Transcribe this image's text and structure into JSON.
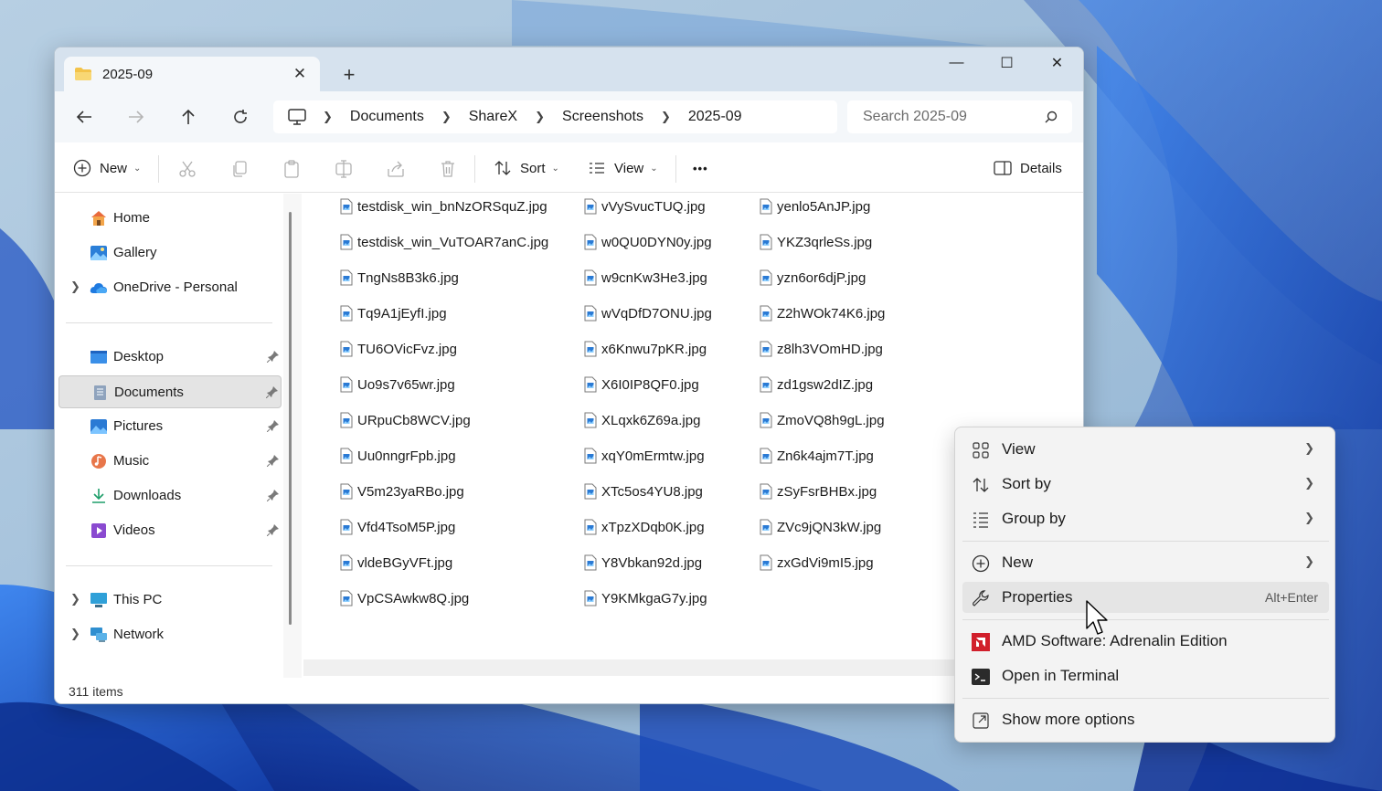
{
  "window": {
    "tab_title": "2025-09",
    "controls": {
      "minimize": "—",
      "maximize": "☐",
      "close": "✕"
    }
  },
  "nav": {
    "back_icon": "arrow-left-icon",
    "forward_icon": "arrow-right-icon",
    "up_icon": "arrow-up-icon",
    "refresh_icon": "refresh-icon",
    "breadcrumbs": [
      "Documents",
      "ShareX",
      "Screenshots",
      "2025-09"
    ],
    "search_placeholder": "Search 2025-09"
  },
  "toolbar": {
    "new_label": "New",
    "sort_label": "Sort",
    "view_label": "View",
    "more_label": "•••",
    "details_label": "Details"
  },
  "sidebar": {
    "home": "Home",
    "gallery": "Gallery",
    "onedrive": "OneDrive - Personal",
    "desktop": "Desktop",
    "documents": "Documents",
    "pictures": "Pictures",
    "music": "Music",
    "downloads": "Downloads",
    "videos": "Videos",
    "thispc": "This PC",
    "network": "Network"
  },
  "files": {
    "col1": [
      "testdisk_win_bnNzORSquZ.jpg",
      "testdisk_win_VuTOAR7anC.jpg",
      "TngNs8B3k6.jpg",
      "Tq9A1jEyfI.jpg",
      "TU6OVicFvz.jpg",
      "Uo9s7v65wr.jpg",
      "URpuCb8WCV.jpg",
      "Uu0nngrFpb.jpg",
      "V5m23yaRBo.jpg",
      "Vfd4TsoM5P.jpg",
      "vldeBGyVFt.jpg",
      "VpCSAwkw8Q.jpg"
    ],
    "col2": [
      "vVySvucTUQ.jpg",
      "w0QU0DYN0y.jpg",
      "w9cnKw3He3.jpg",
      "wVqDfD7ONU.jpg",
      "x6Knwu7pKR.jpg",
      "X6I0IP8QF0.jpg",
      "XLqxk6Z69a.jpg",
      "xqY0mErmtw.jpg",
      "XTc5os4YU8.jpg",
      "xTpzXDqb0K.jpg",
      "Y8Vbkan92d.jpg",
      "Y9KMkgaG7y.jpg"
    ],
    "col3": [
      "yenlo5AnJP.jpg",
      "YKZ3qrleSs.jpg",
      "yzn6or6djP.jpg",
      "Z2hWOk74K6.jpg",
      "z8lh3VOmHD.jpg",
      "zd1gsw2dIZ.jpg",
      "ZmoVQ8h9gL.jpg",
      "Zn6k4ajm7T.jpg",
      "zSyFsrBHBx.jpg",
      "ZVc9jQN3kW.jpg",
      "zxGdVi9mI5.jpg"
    ]
  },
  "status": {
    "items": "311 items"
  },
  "context_menu": {
    "view": "View",
    "sort_by": "Sort by",
    "group_by": "Group by",
    "new": "New",
    "properties": "Properties",
    "properties_shortcut": "Alt+Enter",
    "amd": "AMD Software: Adrenalin Edition",
    "terminal": "Open in Terminal",
    "more_options": "Show more options"
  },
  "colors": {
    "accent": "#0067c0",
    "titlebar": "#d6e2ee",
    "wallpaper": "#9fc0da",
    "wallpaper_bloom": "#1f58c9"
  }
}
